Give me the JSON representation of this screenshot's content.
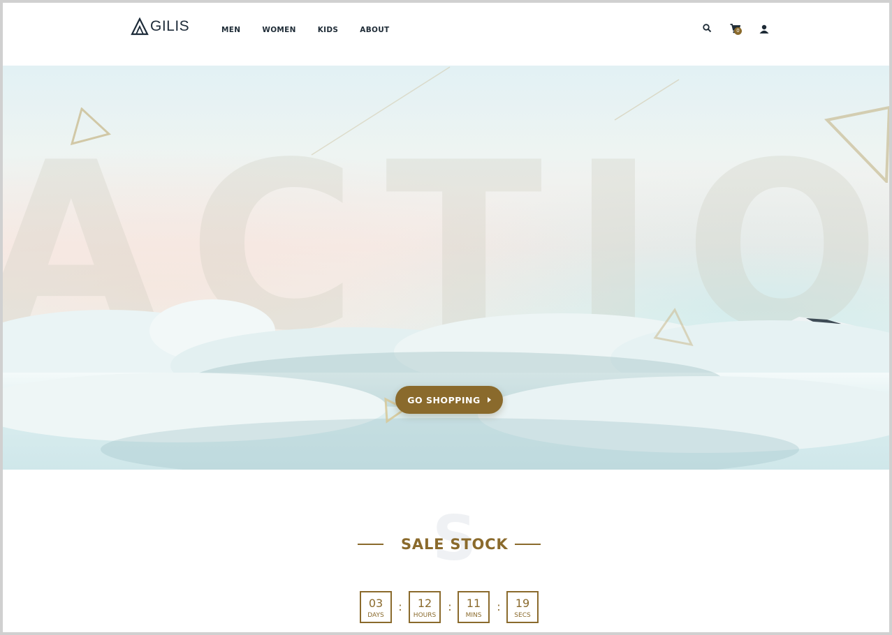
{
  "brand": {
    "logo_text": "GILIS"
  },
  "nav": {
    "items": [
      {
        "label": "MEN"
      },
      {
        "label": "WOMEN"
      },
      {
        "label": "KIDS"
      },
      {
        "label": "ABOUT"
      }
    ]
  },
  "header_icons": {
    "search": "search-icon",
    "cart": "cart-icon",
    "cart_count": "0",
    "user": "user-icon"
  },
  "hero": {
    "background_word": "ACTION",
    "cta_label": "GO SHOPPING"
  },
  "sale": {
    "ghost_letter": "S",
    "title": "SALE STOCK",
    "countdown": [
      {
        "value": "03",
        "label": "DAYS"
      },
      {
        "value": "12",
        "label": "HOURS"
      },
      {
        "value": "11",
        "label": "MINS"
      },
      {
        "value": "19",
        "label": "SECS"
      }
    ],
    "separator": ":"
  },
  "colors": {
    "accent": "#8a6a2c",
    "text_dark": "#1e2b36",
    "background": "#ffffff"
  }
}
